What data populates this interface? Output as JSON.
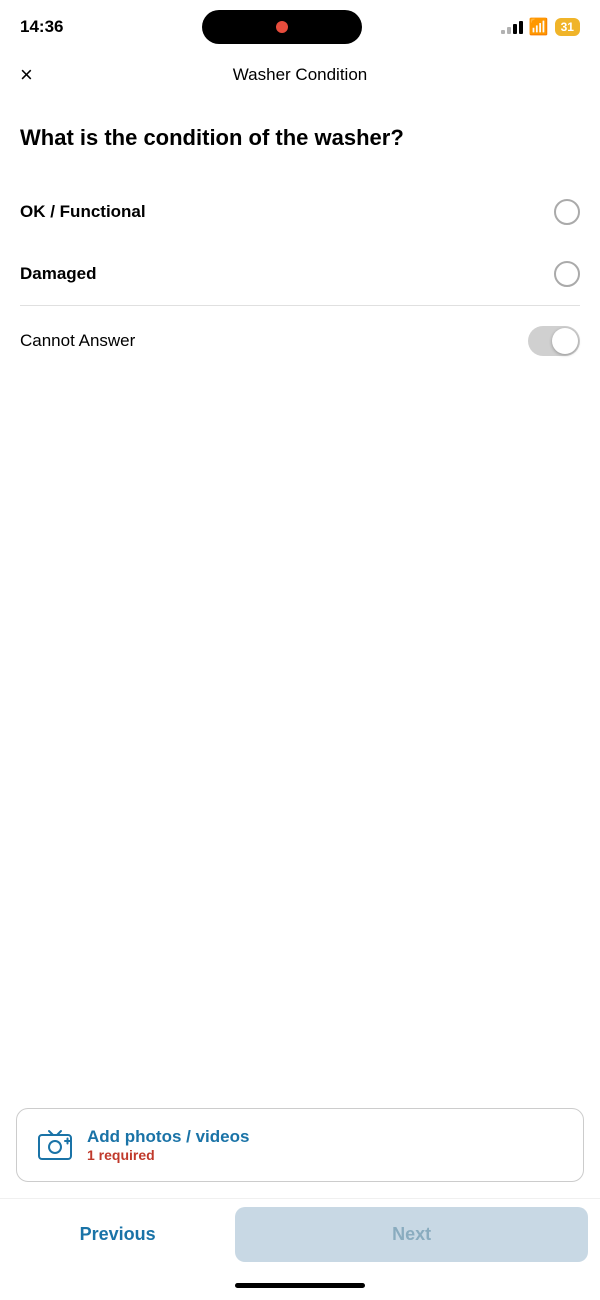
{
  "statusBar": {
    "time": "14:36",
    "batteryLevel": "31"
  },
  "header": {
    "title": "Washer Condition",
    "closeIcon": "×"
  },
  "question": {
    "text": "What is the condition of the washer?"
  },
  "options": [
    {
      "id": "ok",
      "label": "OK / Functional",
      "selected": false
    },
    {
      "id": "damaged",
      "label": "Damaged",
      "selected": false
    }
  ],
  "cannotAnswer": {
    "label": "Cannot Answer",
    "enabled": false
  },
  "addPhotos": {
    "text": "Add photos / videos",
    "required": "1 required"
  },
  "navigation": {
    "previous": "Previous",
    "next": "Next"
  }
}
